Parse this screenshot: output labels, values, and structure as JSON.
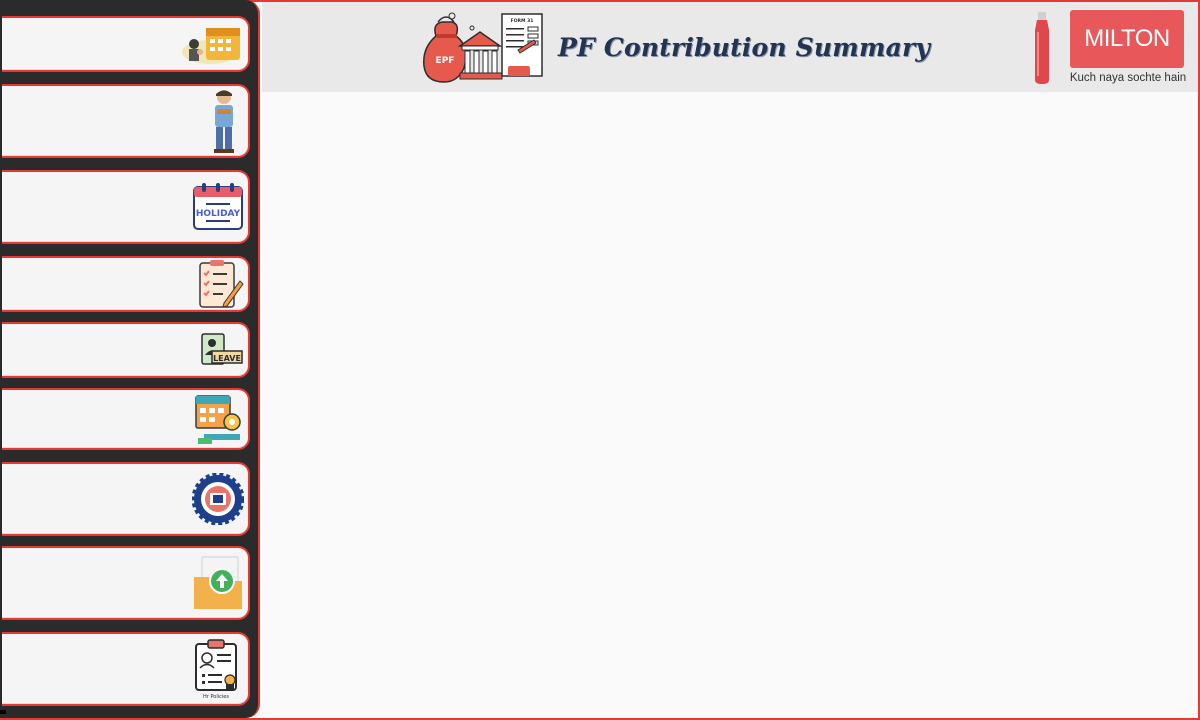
{
  "header": {
    "title": "PF Contribution Summary",
    "epf_badge": "EPF",
    "form_label": "FORM 31"
  },
  "brand": {
    "name": "MILTON",
    "tagline": "Kuch naya sochte hain",
    "color": "#e8585a"
  },
  "accent_color": "#e53935",
  "sidebar": {
    "items": [
      {
        "icon": "calendar-people-icon"
      },
      {
        "icon": "worker-person-icon"
      },
      {
        "icon": "holiday-calendar-icon",
        "label": "HOLIDAY"
      },
      {
        "icon": "checklist-clipboard-icon"
      },
      {
        "icon": "leave-card-icon",
        "label": "LEAVE"
      },
      {
        "icon": "calendar-gear-icon"
      },
      {
        "icon": "epfo-emblem-icon"
      },
      {
        "icon": "folder-upload-icon"
      },
      {
        "icon": "hr-policies-icon",
        "label": "Hr Policies"
      }
    ]
  }
}
